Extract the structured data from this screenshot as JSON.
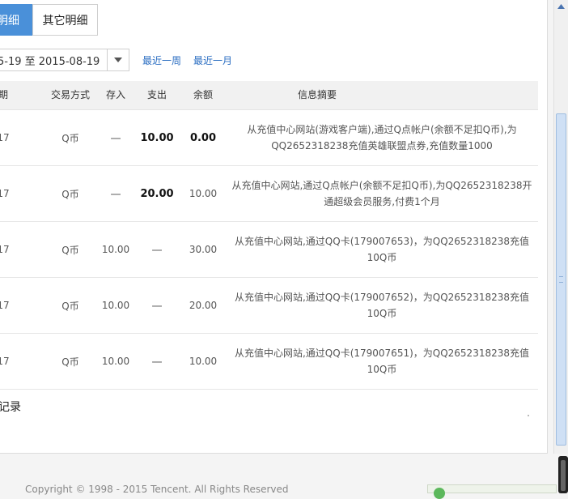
{
  "tabs": {
    "active": "明细",
    "other": "其它明细"
  },
  "date_filter": {
    "range_text": "5-19 至  2015-08-19"
  },
  "quick_links": [
    "最近一周",
    "最近一月"
  ],
  "table": {
    "headers": [
      "期",
      "交易方式",
      "存入",
      "支出",
      "余额",
      "信息摘要"
    ],
    "rows": [
      {
        "date": "17",
        "method": "Q币",
        "deposit": "一",
        "spend": "10.00",
        "balance": "0.00",
        "summary": "从充值中心网站(游戏客户端),通过Q点帐户(余额不足扣Q币),为QQ2652318238充值英雄联盟点券,充值数量1000"
      },
      {
        "date": "17",
        "method": "Q币",
        "deposit": "一",
        "spend": "20.00",
        "balance": "10.00",
        "summary": "从充值中心网站,通过Q点帐户(余额不足扣Q币),为QQ2652318238开通超级会员服务,付费1个月"
      },
      {
        "date": "17",
        "method": "Q币",
        "deposit": "10.00",
        "spend": "一",
        "balance": "30.00",
        "summary": "从充值中心网站,通过QQ卡(179007653)，为QQ2652318238充值10Q币"
      },
      {
        "date": "17",
        "method": "Q币",
        "deposit": "10.00",
        "spend": "一",
        "balance": "20.00",
        "summary": "从充值中心网站,通过QQ卡(179007652)，为QQ2652318238充值10Q币"
      },
      {
        "date": "17",
        "method": "Q币",
        "deposit": "10.00",
        "spend": "一",
        "balance": "10.00",
        "summary": "从充值中心网站,通过QQ卡(179007651)，为QQ2652318238充值10Q币"
      }
    ]
  },
  "footer_label": "记录",
  "copyright": "Copyright © 1998 - 2015 Tencent. All Rights Reserved",
  "colors": {
    "accent": "#4a90d9",
    "link": "#2b6ec2"
  },
  "icons": {
    "dropdown": "chevron-down-icon",
    "scroll_up": "scroll-up-arrow-icon"
  }
}
